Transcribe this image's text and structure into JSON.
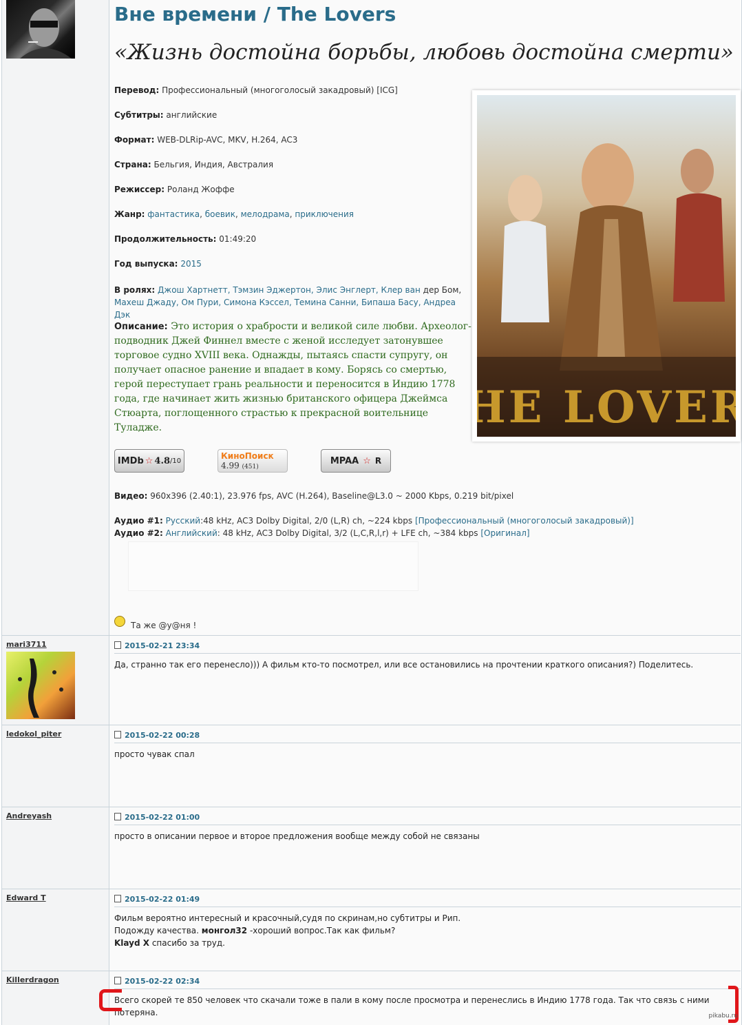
{
  "topic": {
    "title": "Вне времени / The Lovers",
    "tagline": "«Жизнь достойна борьбы, любовь достойна смерти»",
    "fields": {
      "translation_label": "Перевод:",
      "translation": "Профессиональный (многоголосый закадровый) [ICG]",
      "subtitles_label": "Субтитры:",
      "subtitles": "английские",
      "format_label": "Формат:",
      "format": "WEB-DLRip-AVC, MKV, H.264, AC3",
      "country_label": "Страна:",
      "country": "Бельгия, Индия, Австралия",
      "director_label": "Режиссер:",
      "director": "Роланд Жоффе",
      "genre_label": "Жанр:",
      "genres": [
        "фантастика",
        "боевик",
        "мелодрама",
        "приключения"
      ],
      "duration_label": "Продолжительность:",
      "duration": "01:49:20",
      "year_label": "Год выпуска:",
      "year": "2015",
      "cast_label": "В ролях:",
      "cast_line1": "Джош Хартнетт, Тэмзин Эджертон, Элис Энглерт, Клер ван",
      "cast_line1_plain": " дер Бом,",
      "cast_line2": "Махеш Джаду, Ом Пури, Симона Кэссел, Темина Санни, Бипаша Басу, Андреа Дэк",
      "desc_label": "Описание:",
      "description": "Это история о храбрости и великой силе любви. Археолог-подводник Джей Финнел вместе с женой исследует затонувшее торговое судно XVIII века. Однажды, пытаясь спасти супругу, он получает опасное ранение и впадает в кому. Борясь со смертью, герой переступает грань реальности и переносится в Индию 1778 года, где начинает жить жизнью британского офицера Джеймса Стюарта, поглощенного страстью к прекрасной воительнице Туладже."
    },
    "poster_text": "THE LOVERS",
    "ratings": {
      "imdb_label": "IMDb",
      "imdb_value": "4.8",
      "imdb_scale": "/10",
      "kp_label": "КиноПоиск",
      "kp_value": "4.99",
      "kp_votes": "(451)",
      "mpaa_label": "MPAA",
      "mpaa_value": "R"
    },
    "video_label": "Видео:",
    "video": "960x396 (2.40:1), 23.976 fps, AVC (H.264), Baseline@L3.0 ~ 2000 Kbps, 0.219 bit/pixel",
    "audio1_label": "Аудио #1:",
    "audio1_lang": "Русский",
    "audio1": ":48 kHz, AC3 Dolby Digital, 2/0 (L,R) ch, ~224 kbps",
    "audio1_tag": "[Профессиональный (многоголосый закадровый)]",
    "audio2_label": "Аудио #2:",
    "audio2_lang": "Английский",
    "audio2": ": 48 kHz, AC3 Dolby Digital, 3/2 (L,C,R,l,r) + LFE ch, ~384 kbps",
    "audio2_tag": "[Оригинал]",
    "sign": "Та же @у@ня !"
  },
  "posts": [
    {
      "author": "mari3711",
      "date": "2015-02-21 23:34",
      "lines": [
        "Да, странно так его перенесло))) А фильм кто-то посмотрел, или все остановились на прочтении краткого описания?) Поделитесь."
      ]
    },
    {
      "author": "ledokol_piter",
      "date": "2015-02-22 00:28",
      "lines": [
        "просто чувак спал"
      ]
    },
    {
      "author": "Andreyash",
      "date": "2015-02-22 01:00",
      "lines": [
        "просто в описании первое и второе предложения вообще между собой не связаны"
      ]
    },
    {
      "author": "Edward T",
      "date": "2015-02-22 01:49",
      "lines": [
        "Фильм вероятно интересный и красочный,судя по скринам,но субтитры и Рип.",
        "Подожду качества.",
        "монгол32",
        "-хороший вопрос.Так как фильм?",
        "Klayd X",
        "спасибо за труд."
      ]
    },
    {
      "author": "Killerdragon",
      "date": "2015-02-22 02:34",
      "lines": [
        "Всего скорей те 850 человек что скачали тоже в пали в кому после просмотра и перенеслись в Индию 1778 года. Так что связь с ними потеряна."
      ]
    }
  ],
  "watermark": "pikabu.ru"
}
